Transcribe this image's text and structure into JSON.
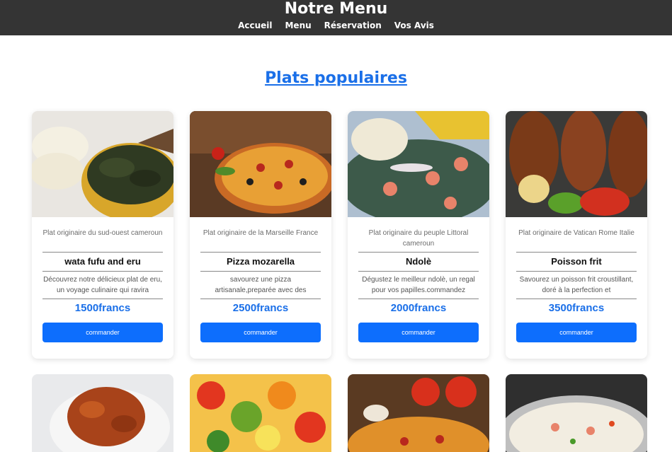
{
  "header": {
    "title": "Notre Menu",
    "nav": [
      "Accueil",
      "Menu",
      "Réservation",
      "Vos Avis"
    ]
  },
  "section_title": "Plats populaires",
  "cards": [
    {
      "origin": "Plat originaire du sud-ouest cameroun",
      "name": "wata fufu and eru",
      "desc": "Découvrez notre délicieux plat de eru, un voyage culinaire qui ravira",
      "price": "1500francs",
      "button": "commander"
    },
    {
      "origin": "Plat originaire de la Marseille France",
      "name": "Pizza mozarella",
      "desc": "savourez une pizza artisanale,preparée avec des",
      "price": "2500francs",
      "button": "commander"
    },
    {
      "origin": "Plat originaire du peuple Littoral cameroun",
      "name": "Ndolè",
      "desc": "Dégustez le meilleur ndolè, un regal pour vos papilles.commandez",
      "price": "2000francs",
      "button": "commander"
    },
    {
      "origin": "Plat originaire de Vatican Rome Italie",
      "name": "Poisson frit",
      "desc": "Savourez un poisson frit croustillant, doré à la perfection et",
      "price": "3500francs",
      "button": "commander"
    }
  ],
  "colors": {
    "header_bg": "#343434",
    "accent": "#1a6fe8",
    "button": "#0d6efd"
  }
}
